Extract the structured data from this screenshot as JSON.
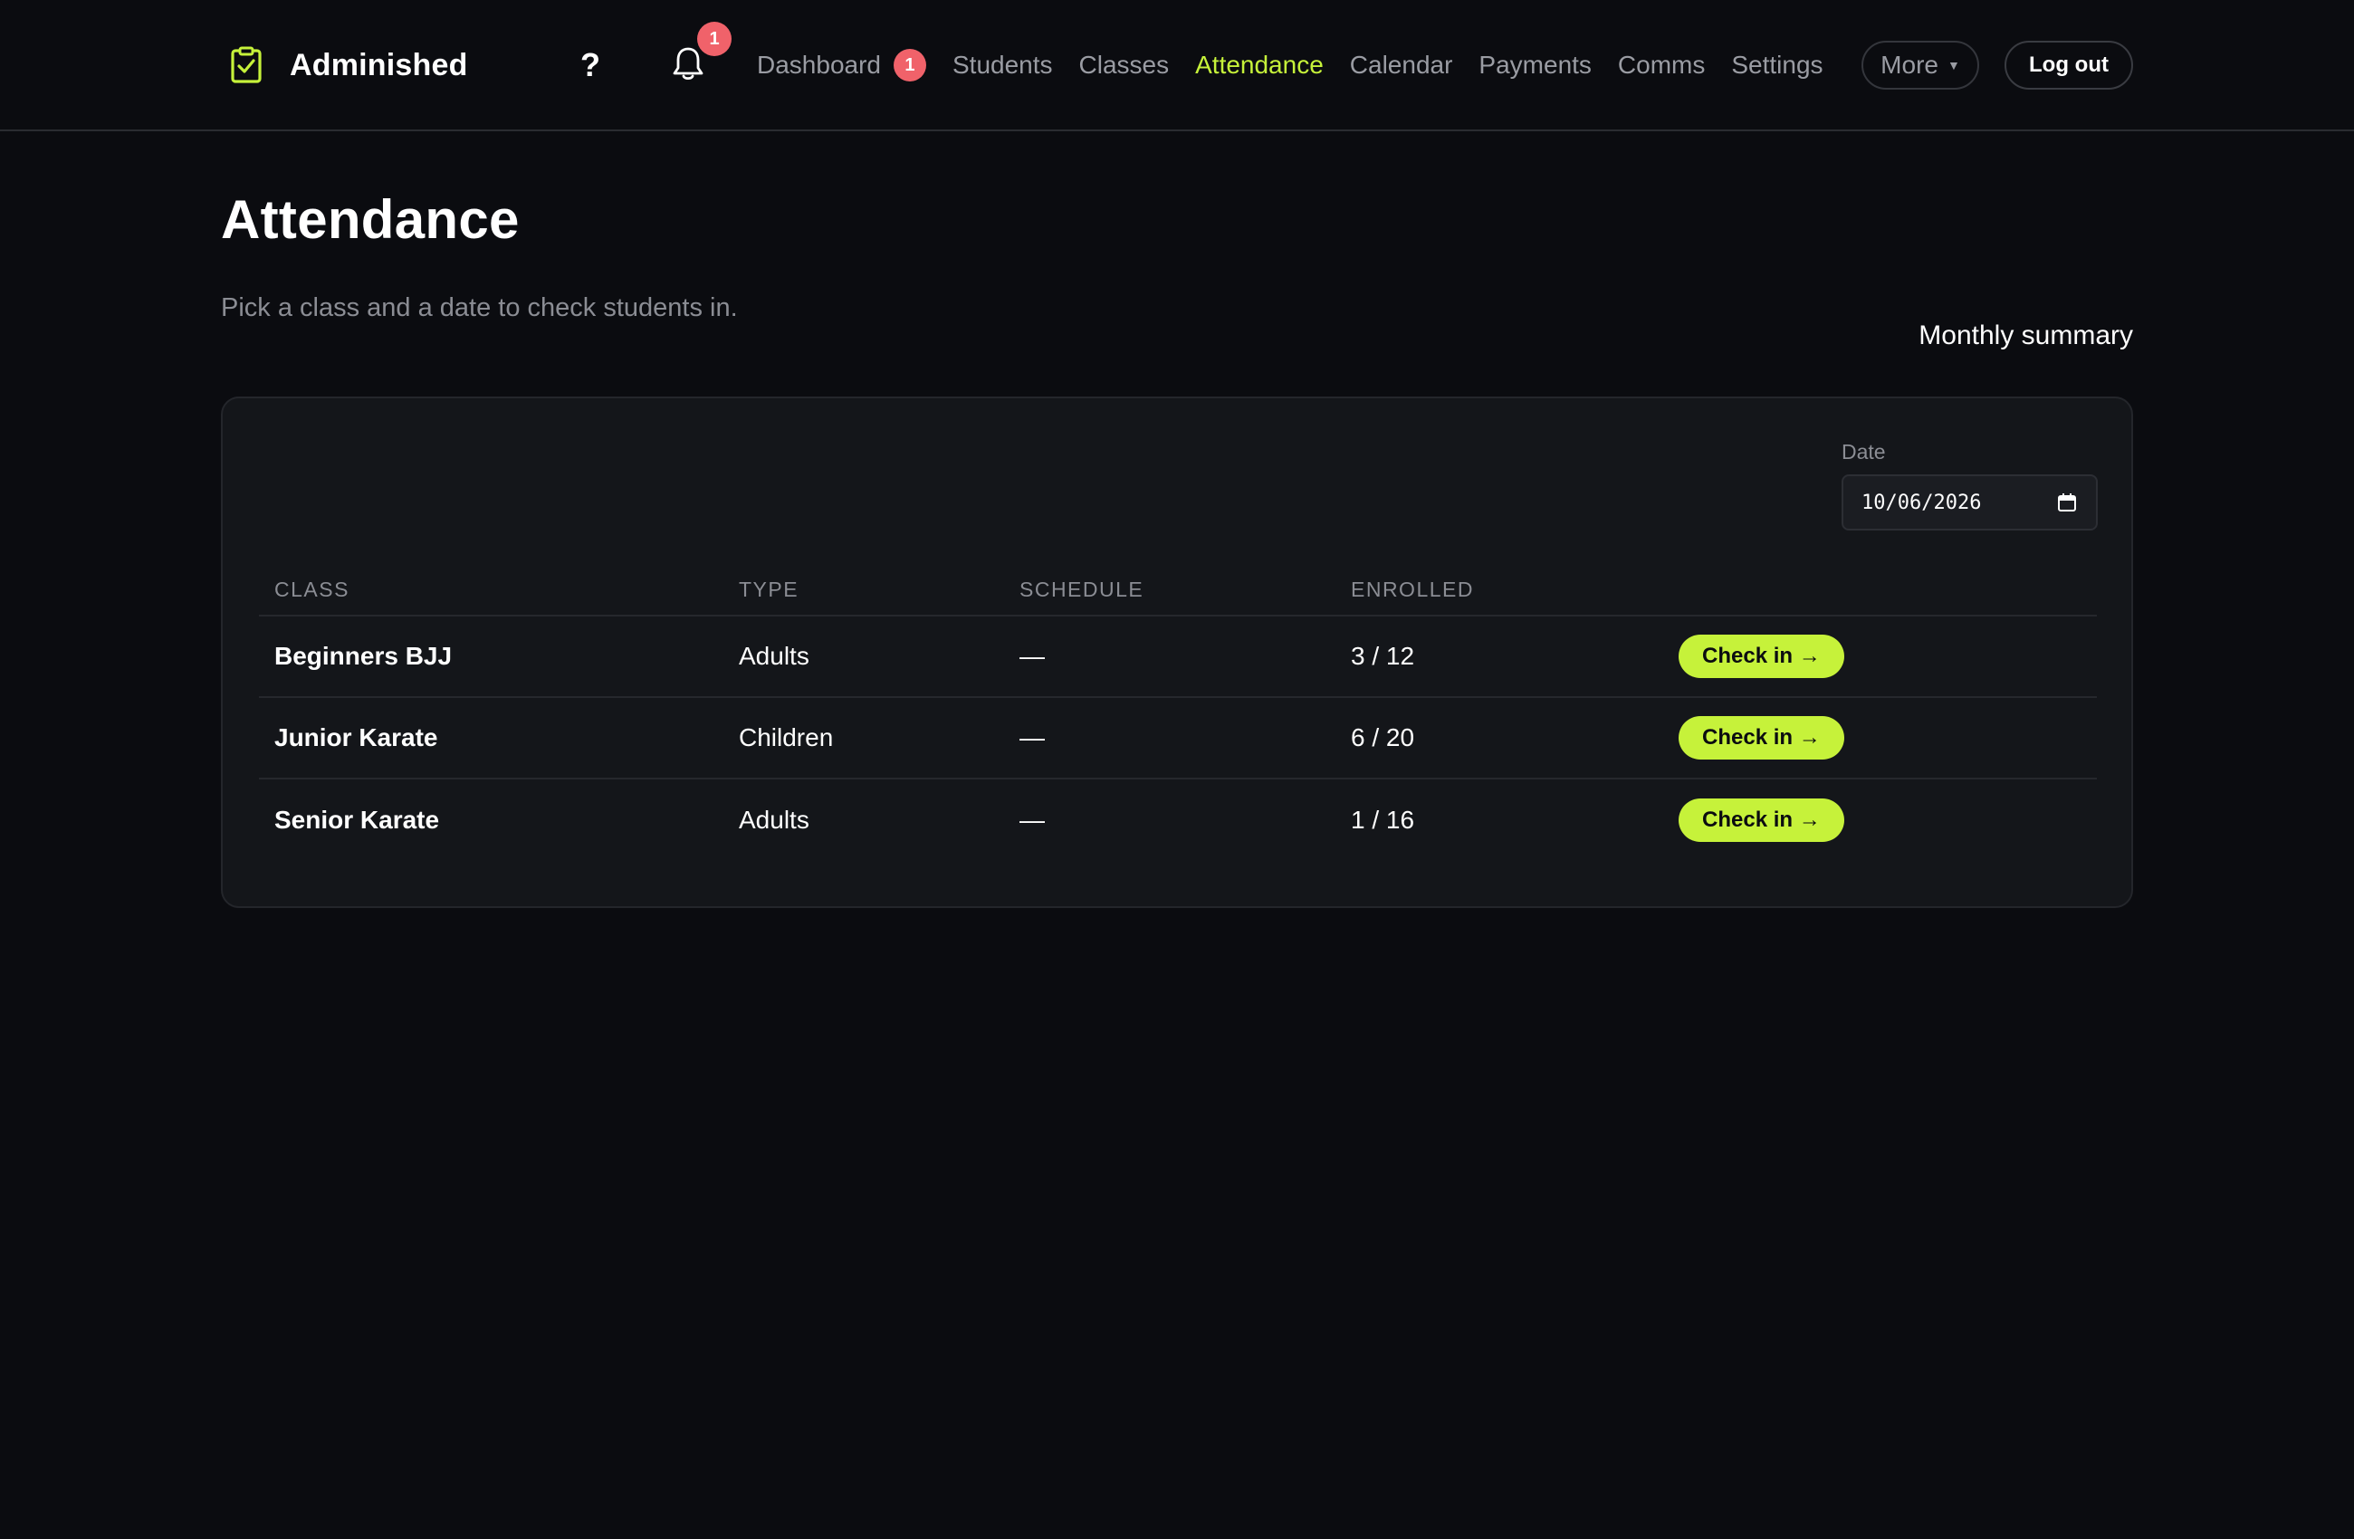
{
  "brand": {
    "name": "Adminished",
    "logo_icon": "clipboard-check-icon",
    "accent": "#c6f23a"
  },
  "header": {
    "help_label": "?",
    "notifications": {
      "icon": "bell-icon",
      "count": "1"
    },
    "nav": [
      {
        "label": "Dashboard",
        "badge": "1",
        "active": false
      },
      {
        "label": "Students",
        "active": false
      },
      {
        "label": "Classes",
        "active": false
      },
      {
        "label": "Attendance",
        "active": true
      },
      {
        "label": "Calendar",
        "active": false
      },
      {
        "label": "Payments",
        "active": false
      },
      {
        "label": "Comms",
        "active": false
      },
      {
        "label": "Settings",
        "active": false
      }
    ],
    "more_label": "More",
    "logout_label": "Log out"
  },
  "page": {
    "title": "Attendance",
    "subtitle": "Pick a class and a date to check students in.",
    "monthly_summary_label": "Monthly summary"
  },
  "filters": {
    "date_label": "Date",
    "date_value": "10/06/2026"
  },
  "table": {
    "columns": [
      "CLASS",
      "TYPE",
      "SCHEDULE",
      "ENROLLED",
      ""
    ],
    "rows": [
      {
        "class": "Beginners BJJ",
        "type": "Adults",
        "schedule": "—",
        "enrolled": "3 / 12",
        "action": "Check in →"
      },
      {
        "class": "Junior Karate",
        "type": "Children",
        "schedule": "—",
        "enrolled": "6 / 20",
        "action": "Check in →"
      },
      {
        "class": "Senior Karate",
        "type": "Adults",
        "schedule": "—",
        "enrolled": "1 / 16",
        "action": "Check in →"
      }
    ]
  },
  "colors": {
    "background": "#0b0c10",
    "card": "#14161a",
    "accent": "#c6f23a",
    "badge": "#f0626a",
    "muted_text": "#8b8d94"
  }
}
